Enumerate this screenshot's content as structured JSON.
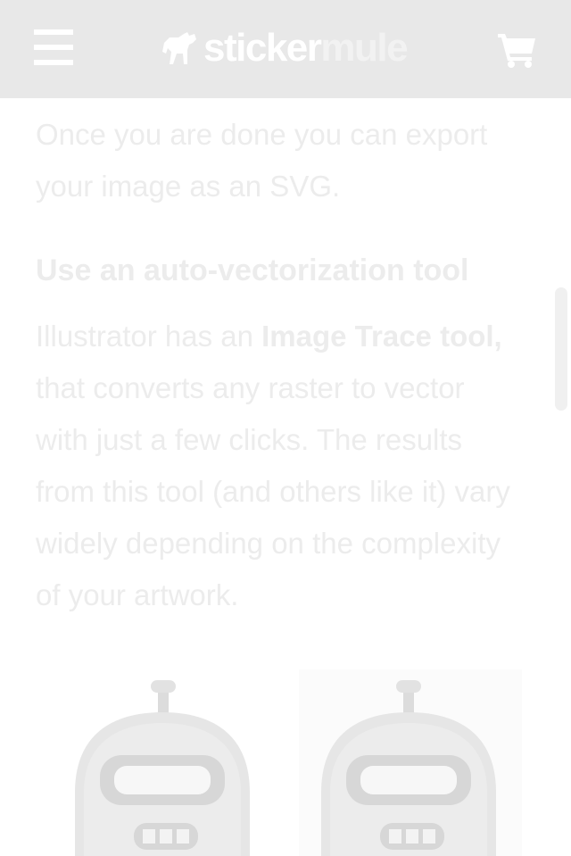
{
  "header": {
    "logo_part1": "sticker",
    "logo_part2": "mule"
  },
  "article": {
    "intro_text": "Once you are done you can export your image as an SVG.",
    "heading": "Use an auto-vectorization tool",
    "para_prefix": "Illustrator has an ",
    "para_bold": "Image Trace tool,",
    "para_suffix": " that converts any raster to vector with just a few clicks. The results from this tool (and others like it) vary widely depending on the complexity of your artwork."
  },
  "icons": {
    "menu": "hamburger-menu-icon",
    "logo": "horse-logo-icon",
    "cart": "shopping-cart-icon"
  },
  "colors": {
    "header_bg": "#e8e8e8",
    "text": "#ececec",
    "page_bg": "#ffffff"
  }
}
